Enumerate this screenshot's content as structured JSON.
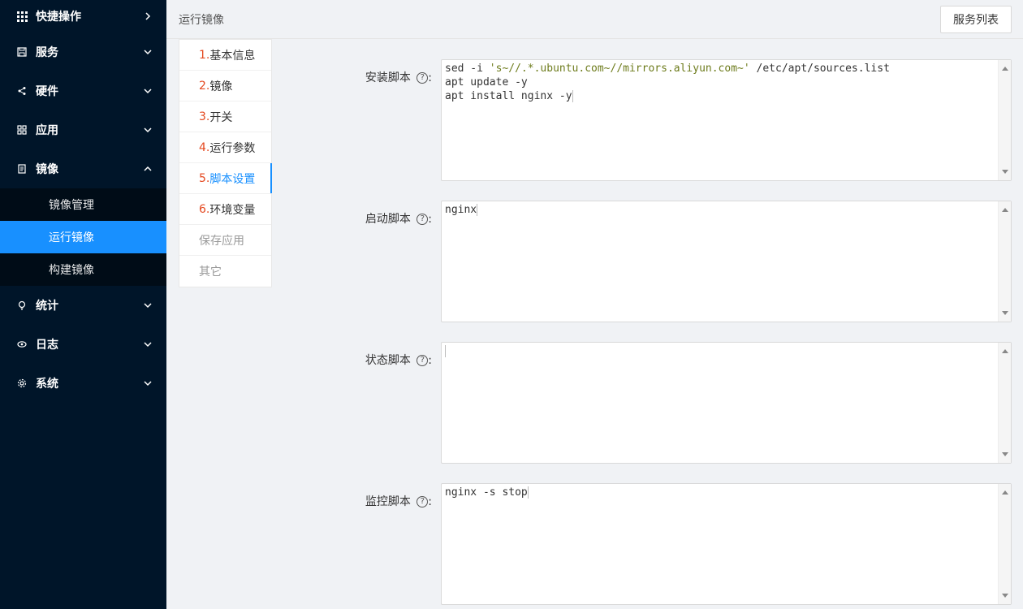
{
  "sidebar": {
    "items": [
      {
        "label": "快捷操作",
        "icon": "grid-icon"
      },
      {
        "label": "服务",
        "icon": "save-icon"
      },
      {
        "label": "硬件",
        "icon": "share-icon"
      },
      {
        "label": "应用",
        "icon": "apps-icon"
      },
      {
        "label": "镜像",
        "icon": "file-icon"
      },
      {
        "label": "统计",
        "icon": "bulb-icon"
      },
      {
        "label": "日志",
        "icon": "eye-icon"
      },
      {
        "label": "系统",
        "icon": "gear-icon"
      }
    ],
    "submenu": [
      "镜像管理",
      "运行镜像",
      "构建镜像"
    ]
  },
  "header": {
    "title": "运行镜像",
    "button": "服务列表"
  },
  "steps": [
    {
      "num": "1.",
      "label": "基本信息"
    },
    {
      "num": "2.",
      "label": "镜像"
    },
    {
      "num": "3.",
      "label": "开关"
    },
    {
      "num": "4.",
      "label": "运行参数"
    },
    {
      "num": "5.",
      "label": "脚本设置"
    },
    {
      "num": "6.",
      "label": "环境变量"
    },
    {
      "num": "",
      "label": "保存应用"
    },
    {
      "num": "",
      "label": "其它"
    }
  ],
  "form": {
    "install": {
      "label": "安装脚本",
      "line1_a": "sed -i ",
      "line1_str": "'s~//.*.ubuntu.com~//mirrors.aliyun.com~'",
      "line1_b": " /etc/apt/sources.list",
      "line2": "apt update -y",
      "line3": "apt install nginx -y"
    },
    "start": {
      "label": "启动脚本",
      "code": "nginx"
    },
    "status": {
      "label": "状态脚本",
      "code": ""
    },
    "monitor": {
      "label": "监控脚本",
      "code": "nginx -s stop"
    },
    "colon": ":"
  },
  "colors": {
    "accent": "#1890ff",
    "sidebar": "#001529",
    "step_num": "#e4481f"
  }
}
